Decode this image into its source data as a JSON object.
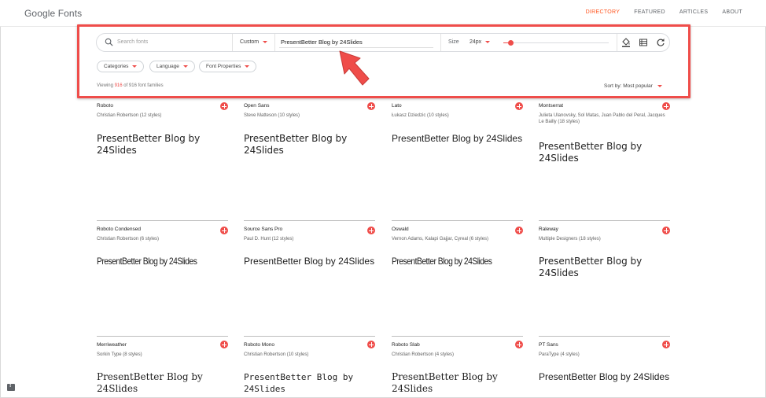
{
  "header": {
    "logo": "Google Fonts",
    "nav": [
      "DIRECTORY",
      "FEATURED",
      "ARTICLES",
      "ABOUT"
    ],
    "active_nav": "DIRECTORY"
  },
  "toolbar": {
    "search_placeholder": "Search fonts",
    "mode": "Custom",
    "preview_text": "PresentBetter Blog by 24Slides",
    "size_label": "Size",
    "size_value": "24px",
    "slider_value": 0.07
  },
  "filters": [
    "Categories",
    "Language",
    "Font Properties"
  ],
  "results": {
    "prefix": "Viewing ",
    "count": "916",
    "suffix": " of 916 font families",
    "sort_label": "Sort by: Most popular"
  },
  "colors": {
    "accent": "#ef4d4a",
    "active_nav": "#ff5722"
  },
  "fonts": [
    {
      "name": "Roboto",
      "designer": "Christian Robertson (12 styles)",
      "sample": "PresentBetter Blog by 24Slides"
    },
    {
      "name": "Open Sans",
      "designer": "Steve Matteson (10 styles)",
      "sample": "PresentBetter Blog by 24Slides"
    },
    {
      "name": "Lato",
      "designer": "Łukasz Dziedzic (10 styles)",
      "sample": "PresentBetter Blog by 24Slides"
    },
    {
      "name": "Montserrat",
      "designer": "Julieta Ulanovsky, Sol Matas, Juan Pablo del Peral, Jacques Le Bailly (18 styles)",
      "sample": "PresentBetter Blog by 24Slides"
    },
    {
      "name": "Roboto Condensed",
      "designer": "Christian Robertson (6 styles)",
      "sample": "PresentBetter Blog by 24Slides"
    },
    {
      "name": "Source Sans Pro",
      "designer": "Paul D. Hunt (12 styles)",
      "sample": "PresentBetter Blog by 24Slides"
    },
    {
      "name": "Oswald",
      "designer": "Vernon Adams, Kalapi Gajjar, Cyreal (6 styles)",
      "sample": "PresentBetter Blog by 24Slides"
    },
    {
      "name": "Raleway",
      "designer": "Multiple Designers (18 styles)",
      "sample": "PresentBetter Blog by 24Slides"
    },
    {
      "name": "Merriweather",
      "designer": "Sorkin Type (8 styles)",
      "sample": "PresentBetter Blog by 24Slides"
    },
    {
      "name": "Roboto Mono",
      "designer": "Christian Robertson (10 styles)",
      "sample": "PresentBetter Blog by 24Slides"
    },
    {
      "name": "Roboto Slab",
      "designer": "Christian Robertson (4 styles)",
      "sample": "PresentBetter Blog by 24Slides"
    },
    {
      "name": "PT Sans",
      "designer": "ParaType (4 styles)",
      "sample": "PresentBetter Blog by 24Slides"
    }
  ]
}
